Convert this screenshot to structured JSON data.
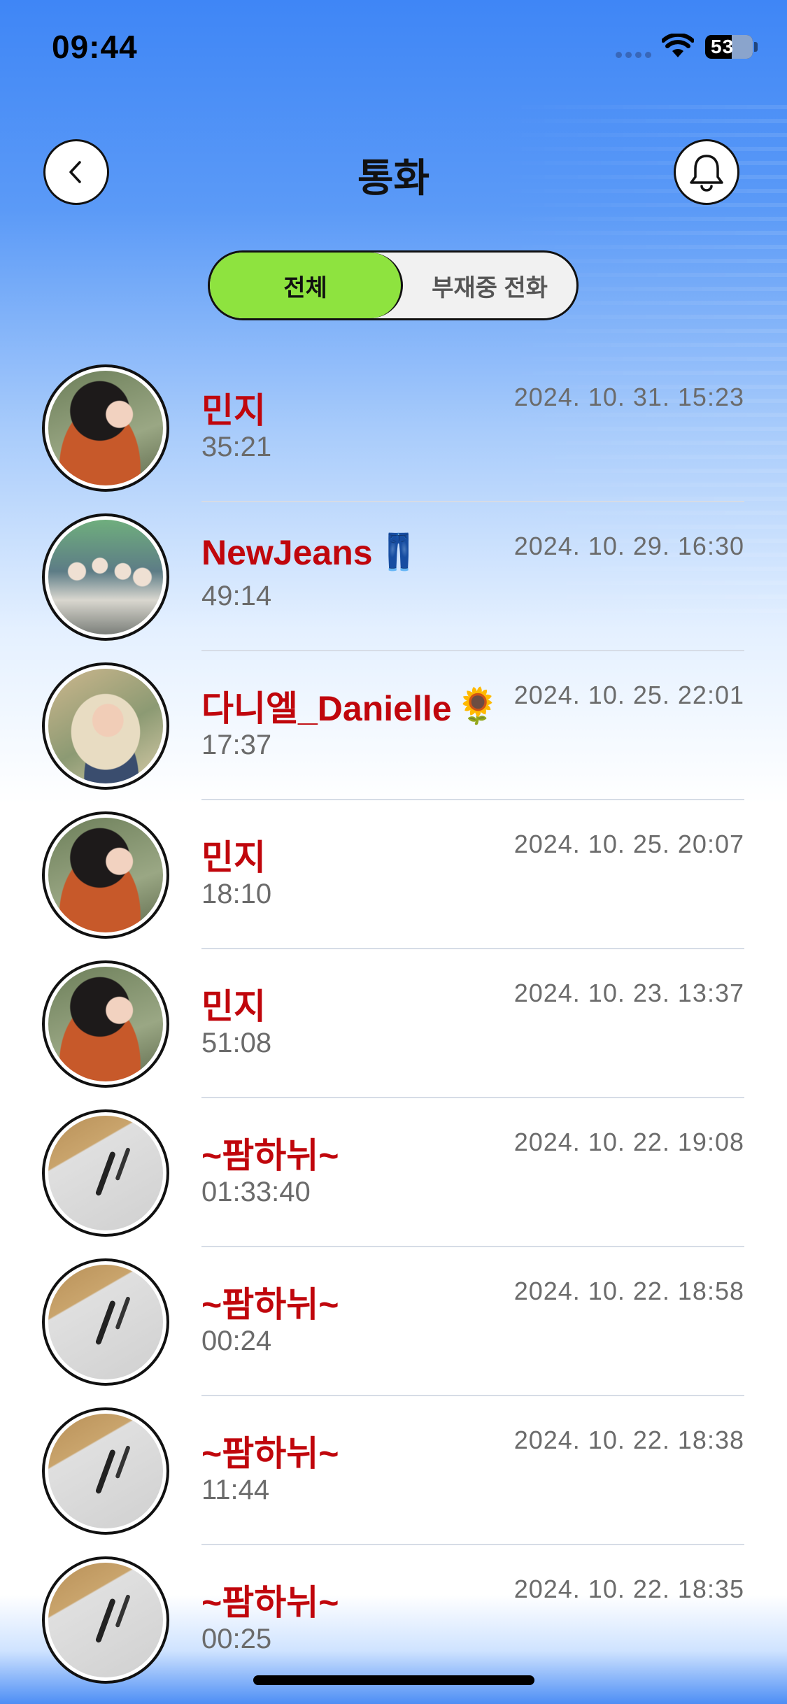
{
  "status_bar": {
    "time": "09:44",
    "battery": "53"
  },
  "header": {
    "title": "통화"
  },
  "tabs": {
    "all": "전체",
    "missed": "부재중 전화"
  },
  "calls": [
    {
      "name": "민지",
      "emoji": "",
      "duration": "35:21",
      "datetime": "2024. 10. 31. 15:23"
    },
    {
      "name": "NewJeans",
      "emoji": "👖",
      "duration": "49:14",
      "datetime": "2024. 10. 29. 16:30"
    },
    {
      "name": "다니엘_Danielle",
      "emoji": "🌻",
      "duration": "17:37",
      "datetime": "2024. 10. 25. 22:01"
    },
    {
      "name": "민지",
      "emoji": "",
      "duration": "18:10",
      "datetime": "2024. 10. 25. 20:07"
    },
    {
      "name": "민지",
      "emoji": "",
      "duration": "51:08",
      "datetime": "2024. 10. 23. 13:37"
    },
    {
      "name": "~팜하뉘~",
      "emoji": "",
      "duration": "01:33:40",
      "datetime": "2024. 10. 22. 19:08"
    },
    {
      "name": "~팜하뉘~",
      "emoji": "",
      "duration": "00:24",
      "datetime": "2024. 10. 22. 18:58"
    },
    {
      "name": "~팜하뉘~",
      "emoji": "",
      "duration": "11:44",
      "datetime": "2024. 10. 22. 18:38"
    },
    {
      "name": "~팜하뉘~",
      "emoji": "",
      "duration": "00:25",
      "datetime": "2024. 10. 22. 18:35"
    }
  ]
}
